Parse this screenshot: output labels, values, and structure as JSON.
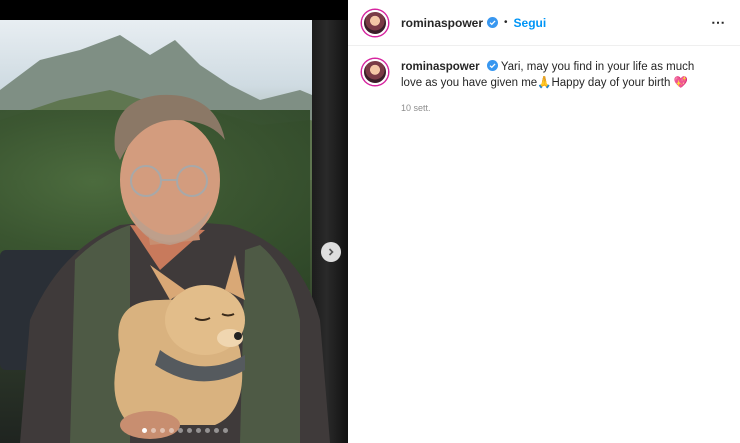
{
  "post": {
    "username": "rominaspower",
    "separator": "•",
    "follow_label": "Segui",
    "more_icon": "⋯",
    "caption_username": "rominaspower",
    "caption_text": "Yari, may you find in your life as much love as you have given me🙏Happy day of your birth 💖",
    "timestamp": "10 sett."
  },
  "carousel": {
    "total_slides": 10,
    "active_slide": 1
  },
  "colors": {
    "follow": "#0095f6",
    "verified": "#3897f0",
    "muted": "#8e8e8e"
  }
}
